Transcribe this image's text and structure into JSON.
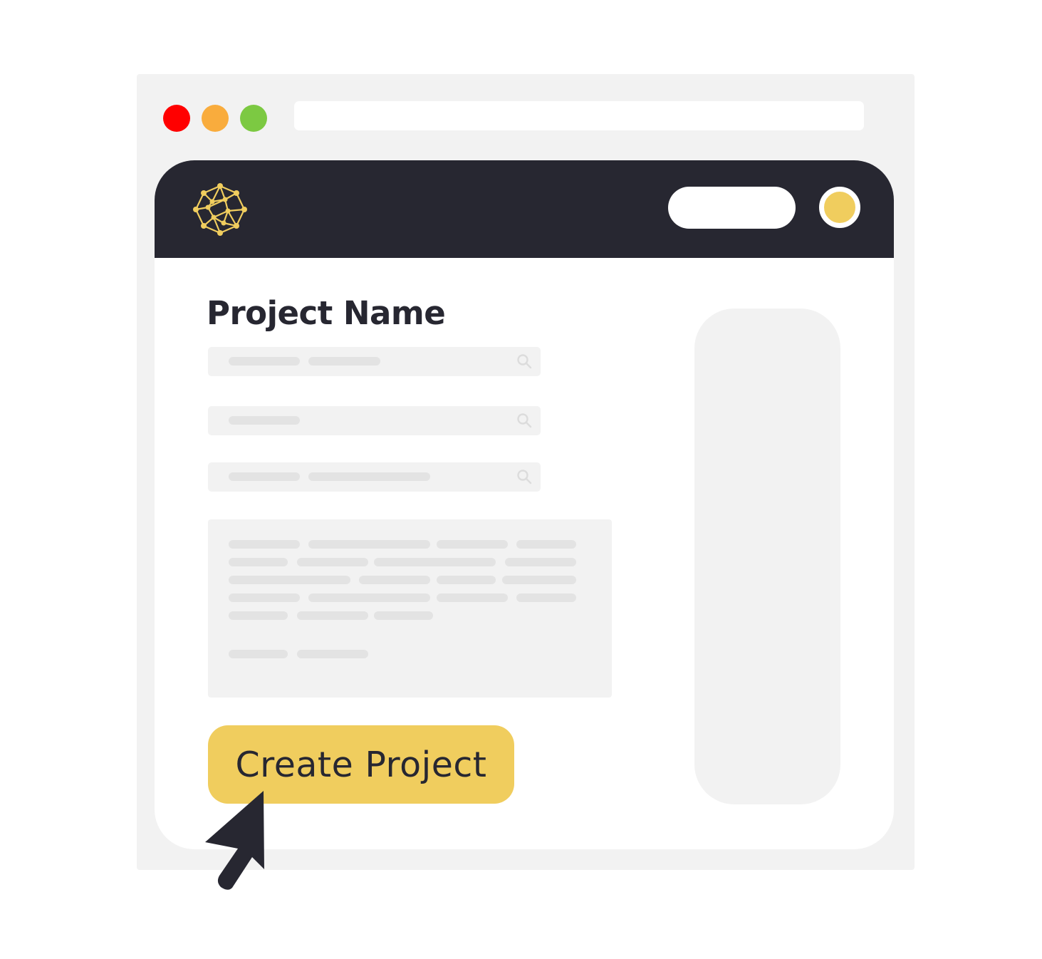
{
  "window": {
    "controls": {
      "close_color": "#ff0000",
      "minimize_color": "#f9ac3d",
      "maximize_color": "#7cc942"
    },
    "address_bar": {
      "value": ""
    }
  },
  "header": {
    "logo_icon": "network-globe-icon",
    "search_pill": {
      "value": ""
    },
    "avatar_color": "#f0cd5e"
  },
  "main": {
    "title": "Project Name",
    "fields": [
      {
        "value": "",
        "icon": "search-icon"
      },
      {
        "value": "",
        "icon": "search-icon"
      },
      {
        "value": "",
        "icon": "search-icon"
      }
    ],
    "description": {
      "value": ""
    },
    "create_button_label": "Create Project"
  },
  "colors": {
    "accent": "#f0cd5e",
    "header_bg": "#272731",
    "text_dark": "#272731",
    "placeholder_bg": "#f2f2f2"
  }
}
